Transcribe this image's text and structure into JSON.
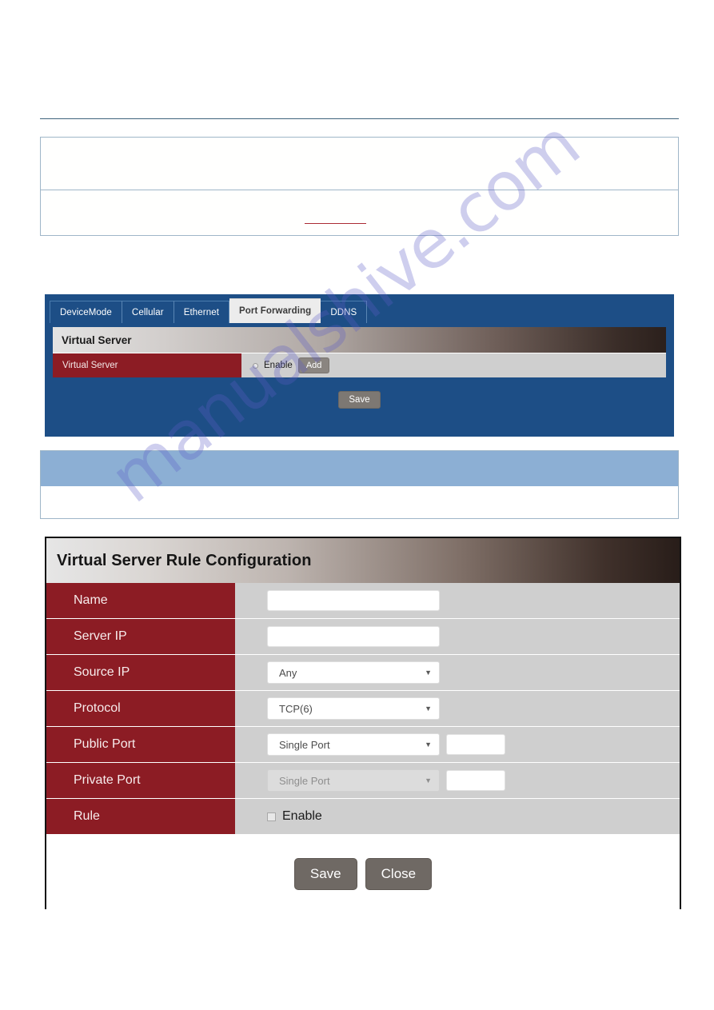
{
  "watermark": {
    "text": "manualshive.com"
  },
  "notes": {
    "box_one_text": "",
    "box_two_text": ""
  },
  "virtual_server_panel": {
    "tabs": [
      {
        "label": "DeviceMode",
        "active": false
      },
      {
        "label": "Cellular",
        "active": false
      },
      {
        "label": "Ethernet",
        "active": false
      },
      {
        "label": "Port Forwarding",
        "active": true
      },
      {
        "label": "DDNS",
        "active": false
      }
    ],
    "header_title": "Virtual Server",
    "row": {
      "label": "Virtual Server",
      "enable_label": "Enable",
      "add_label": "Add"
    },
    "save_label": "Save",
    "colors": {
      "panel_blue": "#1d4e86",
      "label_red": "#8c1c24",
      "button_grey": "#7d7873"
    }
  },
  "band_box": {
    "blue": "#8cafd4"
  },
  "rule_config_panel": {
    "title": "Virtual Server Rule Configuration",
    "rows": [
      {
        "label": "Name",
        "control": "text",
        "value": ""
      },
      {
        "label": "Server IP",
        "control": "text",
        "value": ""
      },
      {
        "label": "Source IP",
        "control": "select",
        "value": "Any",
        "disabled": false
      },
      {
        "label": "Protocol",
        "control": "select",
        "value": "TCP(6)",
        "disabled": false
      },
      {
        "label": "Public Port",
        "control": "select+text",
        "value": "Single Port",
        "port_value": "",
        "disabled": false
      },
      {
        "label": "Private Port",
        "control": "select+text",
        "value": "Single Port",
        "port_value": "",
        "disabled": true
      },
      {
        "label": "Rule",
        "control": "checkbox",
        "value": "Enable",
        "checked": false
      }
    ],
    "save_label": "Save",
    "close_label": "Close",
    "colors": {
      "label_red": "#8c1c24",
      "row_grey": "#cfcfcf",
      "button_grey": "#6f6964"
    }
  }
}
